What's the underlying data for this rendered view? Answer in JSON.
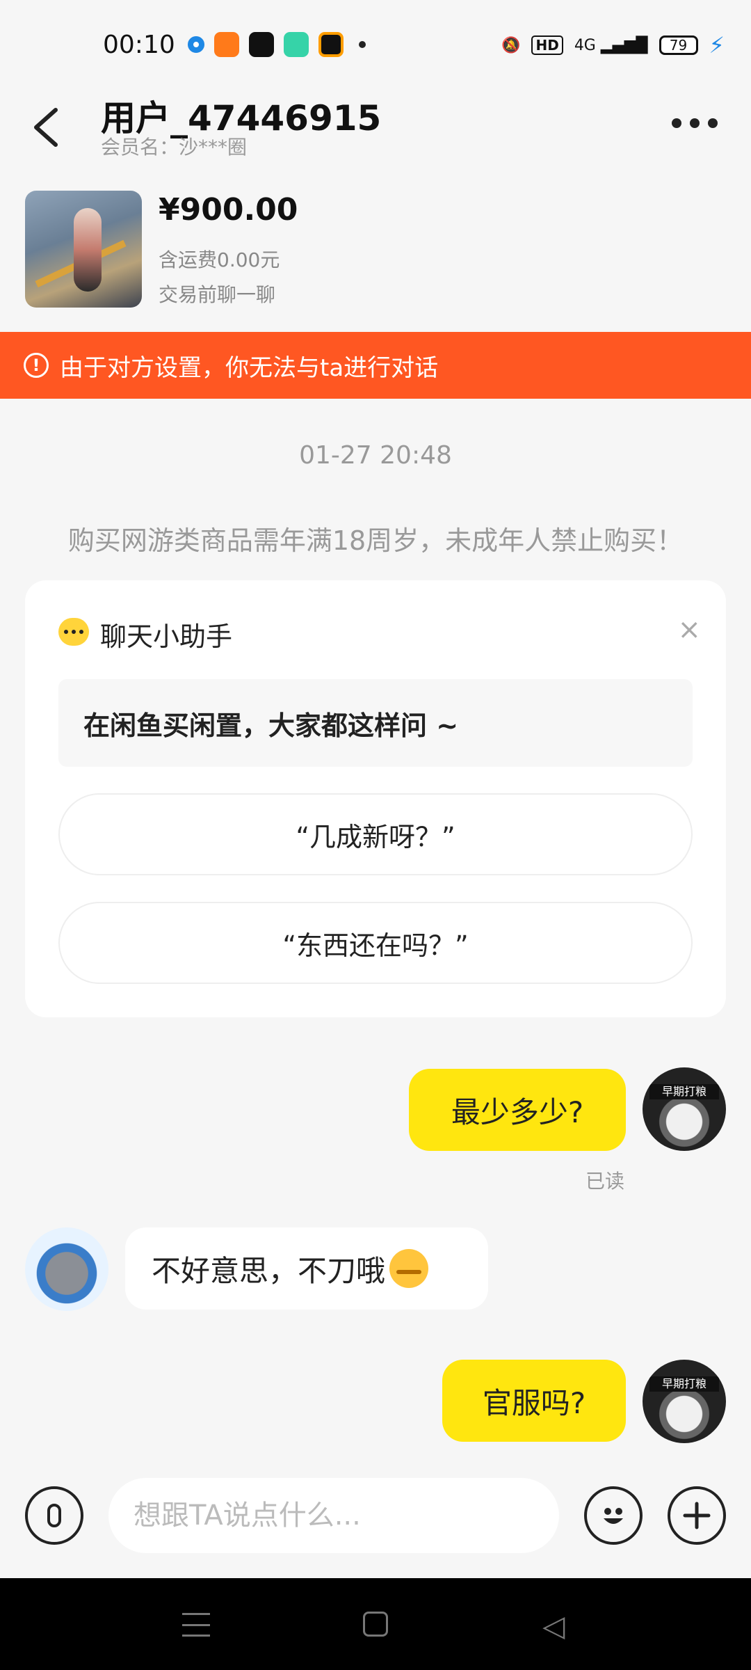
{
  "status_bar": {
    "time": "00:10",
    "network": "4G",
    "battery": "79",
    "hd": "HD"
  },
  "header": {
    "title": "用户_47446915",
    "member_label": "会员名：沙***圈"
  },
  "product": {
    "price": "¥900.00",
    "shipping": "含运费0.00元",
    "hint": "交易前聊一聊"
  },
  "warning": {
    "text": "由于对方设置，你无法与ta进行对话"
  },
  "timestamp": "01-27 20:48",
  "notice": "购买网游类商品需年满18周岁，未成年人禁止购买！",
  "assistant": {
    "title": "聊天小助手",
    "close": "×",
    "subtitle": "在闲鱼买闲置，大家都这样问 ~",
    "quick_questions": [
      "“几成新呀？”",
      "“东西还在吗？”"
    ]
  },
  "messages": [
    {
      "from": "me",
      "text": "最少多少?",
      "status": "已读"
    },
    {
      "from": "other",
      "text": "不好意思，不刀哦"
    },
    {
      "from": "me",
      "text": "官服吗?"
    }
  ],
  "avatar_me_text": "早期打粮",
  "input": {
    "placeholder": "想跟TA说点什么..."
  }
}
